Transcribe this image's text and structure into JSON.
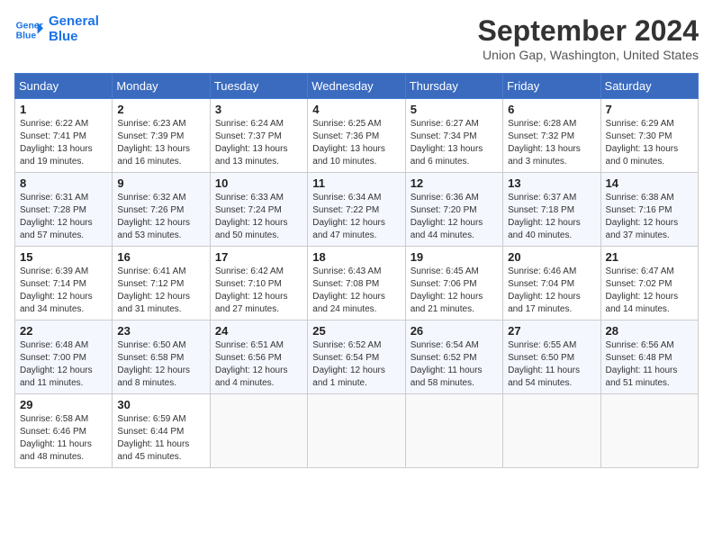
{
  "header": {
    "logo_line1": "General",
    "logo_line2": "Blue",
    "month_title": "September 2024",
    "subtitle": "Union Gap, Washington, United States"
  },
  "weekdays": [
    "Sunday",
    "Monday",
    "Tuesday",
    "Wednesday",
    "Thursday",
    "Friday",
    "Saturday"
  ],
  "weeks": [
    [
      {
        "day": "1",
        "sunrise": "6:22 AM",
        "sunset": "7:41 PM",
        "daylight": "13 hours and 19 minutes."
      },
      {
        "day": "2",
        "sunrise": "6:23 AM",
        "sunset": "7:39 PM",
        "daylight": "13 hours and 16 minutes."
      },
      {
        "day": "3",
        "sunrise": "6:24 AM",
        "sunset": "7:37 PM",
        "daylight": "13 hours and 13 minutes."
      },
      {
        "day": "4",
        "sunrise": "6:25 AM",
        "sunset": "7:36 PM",
        "daylight": "13 hours and 10 minutes."
      },
      {
        "day": "5",
        "sunrise": "6:27 AM",
        "sunset": "7:34 PM",
        "daylight": "13 hours and 6 minutes."
      },
      {
        "day": "6",
        "sunrise": "6:28 AM",
        "sunset": "7:32 PM",
        "daylight": "13 hours and 3 minutes."
      },
      {
        "day": "7",
        "sunrise": "6:29 AM",
        "sunset": "7:30 PM",
        "daylight": "13 hours and 0 minutes."
      }
    ],
    [
      {
        "day": "8",
        "sunrise": "6:31 AM",
        "sunset": "7:28 PM",
        "daylight": "12 hours and 57 minutes."
      },
      {
        "day": "9",
        "sunrise": "6:32 AM",
        "sunset": "7:26 PM",
        "daylight": "12 hours and 53 minutes."
      },
      {
        "day": "10",
        "sunrise": "6:33 AM",
        "sunset": "7:24 PM",
        "daylight": "12 hours and 50 minutes."
      },
      {
        "day": "11",
        "sunrise": "6:34 AM",
        "sunset": "7:22 PM",
        "daylight": "12 hours and 47 minutes."
      },
      {
        "day": "12",
        "sunrise": "6:36 AM",
        "sunset": "7:20 PM",
        "daylight": "12 hours and 44 minutes."
      },
      {
        "day": "13",
        "sunrise": "6:37 AM",
        "sunset": "7:18 PM",
        "daylight": "12 hours and 40 minutes."
      },
      {
        "day": "14",
        "sunrise": "6:38 AM",
        "sunset": "7:16 PM",
        "daylight": "12 hours and 37 minutes."
      }
    ],
    [
      {
        "day": "15",
        "sunrise": "6:39 AM",
        "sunset": "7:14 PM",
        "daylight": "12 hours and 34 minutes."
      },
      {
        "day": "16",
        "sunrise": "6:41 AM",
        "sunset": "7:12 PM",
        "daylight": "12 hours and 31 minutes."
      },
      {
        "day": "17",
        "sunrise": "6:42 AM",
        "sunset": "7:10 PM",
        "daylight": "12 hours and 27 minutes."
      },
      {
        "day": "18",
        "sunrise": "6:43 AM",
        "sunset": "7:08 PM",
        "daylight": "12 hours and 24 minutes."
      },
      {
        "day": "19",
        "sunrise": "6:45 AM",
        "sunset": "7:06 PM",
        "daylight": "12 hours and 21 minutes."
      },
      {
        "day": "20",
        "sunrise": "6:46 AM",
        "sunset": "7:04 PM",
        "daylight": "12 hours and 17 minutes."
      },
      {
        "day": "21",
        "sunrise": "6:47 AM",
        "sunset": "7:02 PM",
        "daylight": "12 hours and 14 minutes."
      }
    ],
    [
      {
        "day": "22",
        "sunrise": "6:48 AM",
        "sunset": "7:00 PM",
        "daylight": "12 hours and 11 minutes."
      },
      {
        "day": "23",
        "sunrise": "6:50 AM",
        "sunset": "6:58 PM",
        "daylight": "12 hours and 8 minutes."
      },
      {
        "day": "24",
        "sunrise": "6:51 AM",
        "sunset": "6:56 PM",
        "daylight": "12 hours and 4 minutes."
      },
      {
        "day": "25",
        "sunrise": "6:52 AM",
        "sunset": "6:54 PM",
        "daylight": "12 hours and 1 minute."
      },
      {
        "day": "26",
        "sunrise": "6:54 AM",
        "sunset": "6:52 PM",
        "daylight": "11 hours and 58 minutes."
      },
      {
        "day": "27",
        "sunrise": "6:55 AM",
        "sunset": "6:50 PM",
        "daylight": "11 hours and 54 minutes."
      },
      {
        "day": "28",
        "sunrise": "6:56 AM",
        "sunset": "6:48 PM",
        "daylight": "11 hours and 51 minutes."
      }
    ],
    [
      {
        "day": "29",
        "sunrise": "6:58 AM",
        "sunset": "6:46 PM",
        "daylight": "11 hours and 48 minutes."
      },
      {
        "day": "30",
        "sunrise": "6:59 AM",
        "sunset": "6:44 PM",
        "daylight": "11 hours and 45 minutes."
      },
      null,
      null,
      null,
      null,
      null
    ]
  ],
  "labels": {
    "sunrise": "Sunrise:",
    "sunset": "Sunset:",
    "daylight": "Daylight:"
  }
}
